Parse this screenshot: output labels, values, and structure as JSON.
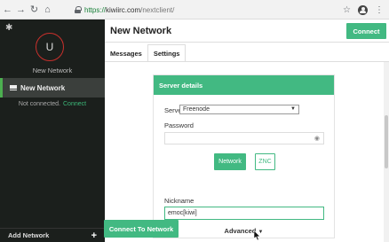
{
  "browser": {
    "url_scheme": "https://",
    "url_host": "kiwiirc.com",
    "url_path": "/nextclient/"
  },
  "sidebar": {
    "avatar_letter": "U",
    "network_label": "New Network",
    "active_network": "New Network",
    "status_text": "Not connected.",
    "status_link": "Connect",
    "add_network_label": "Add Network"
  },
  "main": {
    "title": "New Network",
    "connect_label": "Connect",
    "tabs": [
      {
        "label": "Messages"
      },
      {
        "label": "Settings"
      }
    ]
  },
  "server_details": {
    "heading": "Server details",
    "server_label": "Server",
    "server_value": "Freenode",
    "password_label": "Password",
    "password_value": "",
    "network_button": "Network",
    "znc_button": "ZNC",
    "nickname_label": "Nickname",
    "nickname_value": "emoc[kiwi]",
    "advanced_label": "Advanced",
    "connect_network_label": "Connect To Network"
  },
  "colors": {
    "accent": "#42b982",
    "sidebar_bg": "#1b1f1c",
    "avatar_ring": "#c9302c"
  }
}
